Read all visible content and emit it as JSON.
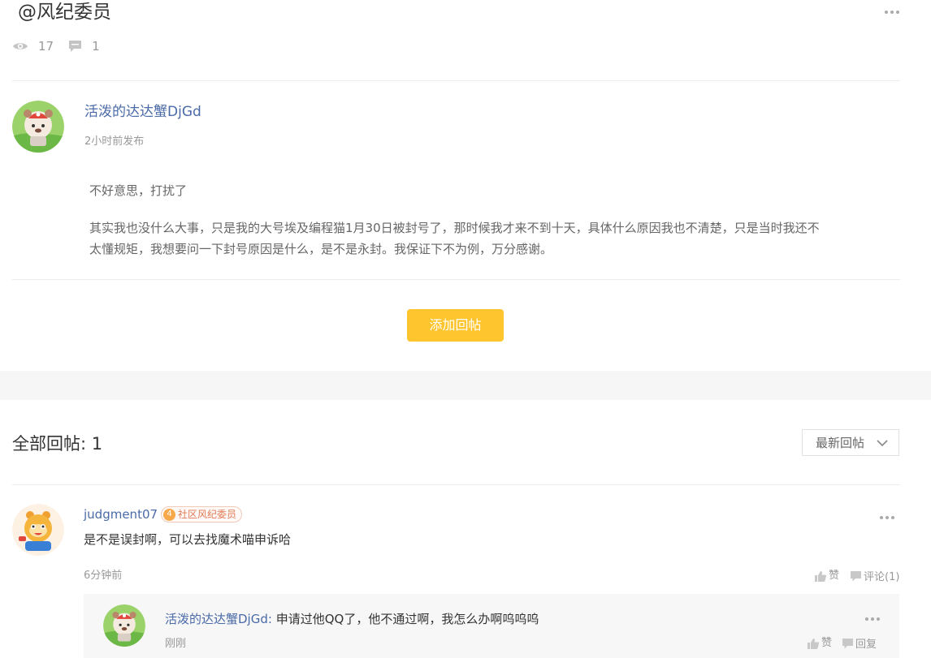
{
  "post": {
    "title": "@风纪委员",
    "views": "17",
    "comments": "1",
    "author": "活泼的达达蟹DjGd",
    "time": "2小时前发布",
    "paragraph1": "不好意思，打扰了",
    "paragraph2": "其实我也没什么大事，只是我的大号埃及编程猫1月30日被封号了，那时候我才来不到十天，具体什么原因我也不清楚，只是当时我还不太懂规矩，我想要问一下封号原因是什么，是不是永封。我保证下不为例，万分感谢。",
    "add_reply_label": "添加回帖"
  },
  "replies": {
    "heading": "全部回帖: 1",
    "sort_label": "最新回帖",
    "items": [
      {
        "user": "judgment07",
        "badge_level": "4",
        "badge_label": "社区风纪委员",
        "text": "是不是误封啊，可以去找魔术喵申诉哈",
        "time": "6分钟前",
        "like_label": "赞",
        "comment_label": "评论(1)",
        "sub_replies": [
          {
            "user": "活泼的达达蟹DjGd",
            "separator": ": ",
            "text": "申请过他QQ了，他不通过啊，我怎么办啊呜呜呜",
            "time": "刚刚",
            "like_label": "赞",
            "reply_label": "回复"
          }
        ]
      }
    ]
  },
  "icons": {
    "views": "eye-icon",
    "comments": "comment-bubble-icon",
    "more": "more-dots-icon",
    "sort": "chevron-down-icon",
    "like": "thumbs-up-icon",
    "reply": "comment-icon"
  },
  "colors": {
    "accent": "#fec52e",
    "link": "#4a6aa8",
    "muted": "#999999",
    "divider": "#ececec",
    "section_gap": "#f6f6f6"
  }
}
